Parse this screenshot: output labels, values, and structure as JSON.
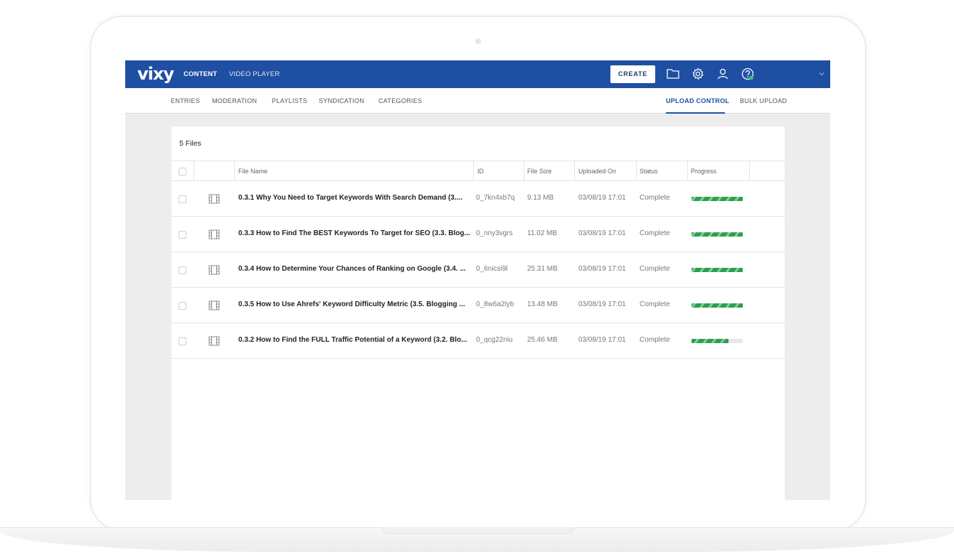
{
  "app": {
    "logo": "vixy",
    "nav": {
      "content": "CONTENT",
      "video_player": "VIDEO PLAYER"
    },
    "create_label": "CREATE",
    "icons": [
      "folder-icon",
      "gear-icon",
      "user-icon",
      "help-icon",
      "chevron-down-icon"
    ],
    "accent_color": "#1f4fa3"
  },
  "subnav": {
    "entries": "ENTRIES",
    "moderation": "MODERATION",
    "playlists": "PLAYLISTS",
    "syndication": "SYNDICATION",
    "categories": "CATEGORIES",
    "upload_control": "UPLOAD CONTROL",
    "bulk_upload": "BULK UPLOAD",
    "active": "UPLOAD CONTROL"
  },
  "panel": {
    "file_count": "5 Files",
    "columns": {
      "file_name": "File Name",
      "id": "ID",
      "file_size": "File Size",
      "uploaded_on": "Uploaded On",
      "status": "Status",
      "progress": "Progress"
    },
    "rows": [
      {
        "name": "0.3.1 Why You Need to Target Keywords With Search Demand (3....",
        "id": "0_7kn4xb7q",
        "size": "9.13 MB",
        "uploaded": "03/08/19 17:01",
        "status": "Complete",
        "progress": 1.0
      },
      {
        "name": "0.3.3 How to Find The BEST Keywords To Target for SEO (3.3. Blog...",
        "id": "0_nny3vgrs",
        "size": "11.02 MB",
        "uploaded": "03/08/19 17:01",
        "status": "Complete",
        "progress": 1.0
      },
      {
        "name": "0.3.4 How to Determine Your Chances of Ranking on Google (3.4. ...",
        "id": "0_6nicsi9l",
        "size": "25.31 MB",
        "uploaded": "03/08/19 17:01",
        "status": "Complete",
        "progress": 1.0
      },
      {
        "name": "0.3.5 How to Use Ahrefs' Keyword Difficulty Metric (3.5. Blogging ...",
        "id": "0_8w6a2lyb",
        "size": "13.48 MB",
        "uploaded": "03/08/19 17:01",
        "status": "Complete",
        "progress": 1.0
      },
      {
        "name": "0.3.2 How to Find the FULL Traffic Potential of a Keyword (3.2. Blo...",
        "id": "0_qcg22niu",
        "size": "25.46 MB",
        "uploaded": "03/08/19 17:01",
        "status": "Complete",
        "progress": 0.72
      }
    ]
  }
}
